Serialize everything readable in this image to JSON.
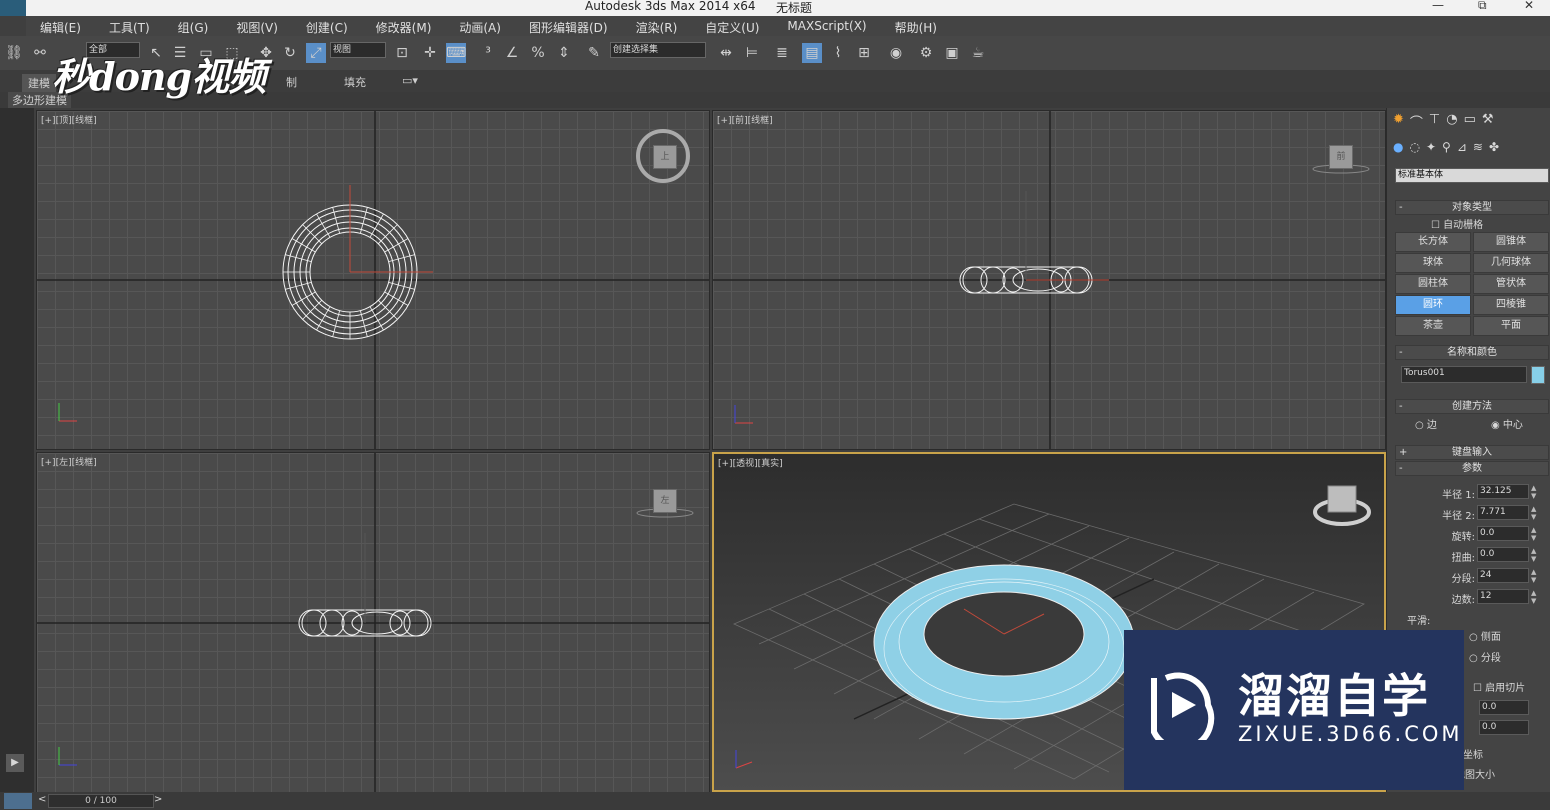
{
  "titlebar": {
    "title": "Autodesk 3ds Max  2014 x64",
    "doc": "无标题",
    "minimize": "—",
    "restore": "⧉",
    "close": "✕"
  },
  "menu": [
    "编辑(E)",
    "工具(T)",
    "组(G)",
    "视图(V)",
    "创建(C)",
    "修改器(M)",
    "动画(A)",
    "图形编辑器(D)",
    "渲染(R)",
    "自定义(U)",
    "MAXScript(X)",
    "帮助(H)"
  ],
  "toolbar": {
    "selection_filter": "全部",
    "ref_coord": "视图",
    "named_selection": "创建选择集"
  },
  "ribbon": {
    "tab_modeling": "建模",
    "tab_freeform": "制",
    "tab_fill": "填充",
    "sub_label": "多边形建模"
  },
  "watermark_top": "秒dong视频",
  "viewports": {
    "top_label": "[+][顶][线框]",
    "front_label": "[+][前][线框]",
    "left_label": "[+][左][线框]",
    "persp_label": "[+][透视][真实]",
    "cube_top": "上",
    "cube_front": "前",
    "cube_left": "左"
  },
  "command_panel": {
    "category": "标准基本体",
    "object_type_title": "对象类型",
    "autogrid": "自动栅格",
    "objects": [
      "长方体",
      "圆锥体",
      "球体",
      "几何球体",
      "圆柱体",
      "管状体",
      "圆环",
      "四棱锥",
      "茶壶",
      "平面"
    ],
    "active_object": "圆环",
    "name_color_title": "名称和颜色",
    "object_name": "Torus001",
    "object_color": "#87cfe8",
    "creation_method_title": "创建方法",
    "method_edge": "边",
    "method_center": "中心",
    "keyboard_entry_title": "键盘输入",
    "parameters_title": "参数",
    "params": [
      {
        "label": "半径 1:",
        "value": "32.125"
      },
      {
        "label": "半径 2:",
        "value": "7.771"
      },
      {
        "label": "旋转:",
        "value": "0.0"
      },
      {
        "label": "扭曲:",
        "value": "0.0"
      },
      {
        "label": "分段:",
        "value": "24"
      },
      {
        "label": "边数:",
        "value": "12"
      }
    ],
    "smooth_title": "平滑:",
    "smooth_sides": "侧面",
    "smooth_segments": "分段",
    "slice_on": "启用切片",
    "slice_from": "0.0",
    "slice_to": "0.0",
    "gen_coords": "坐标",
    "real_world": "地图大小"
  },
  "timeline": {
    "frame": "0 / 100"
  },
  "zixue": {
    "cn": "溜溜自学",
    "en": "ZIXUE.3D66.COM"
  }
}
